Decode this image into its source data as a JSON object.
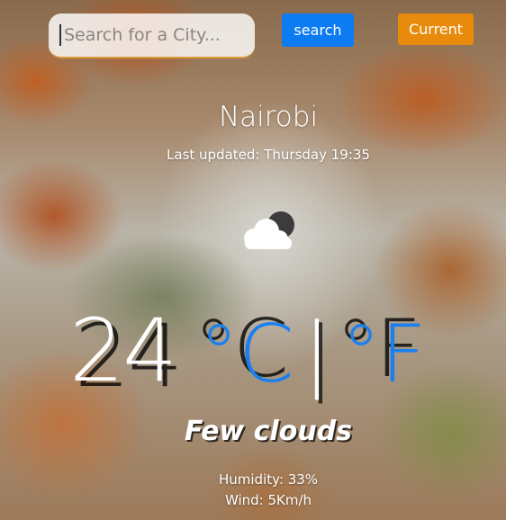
{
  "search": {
    "placeholder": "Search for a City...",
    "value": "",
    "button_label": "search"
  },
  "current_button_label": "Current",
  "weather": {
    "city": "Nairobi",
    "last_updated": "Last updated: Thursday 19:35",
    "icon": "few-clouds-night-icon",
    "temperature": "24",
    "unit_celsius": "°C",
    "unit_separator": "|",
    "unit_fahrenheit": "°F",
    "description": "Few clouds",
    "humidity": "Humidity: 33%",
    "wind": "Wind: 5Km/h"
  },
  "colors": {
    "search_button": "#0d7bf2",
    "current_button": "#e88a0c",
    "unit_accent": "#1a80f0"
  }
}
